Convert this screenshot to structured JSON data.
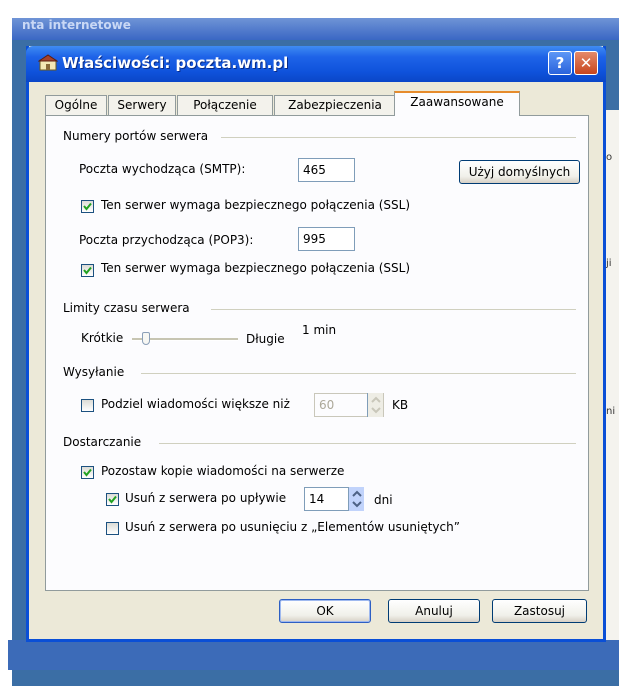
{
  "background": {
    "window_title_fragment": "nta internetowe",
    "right_fragments": [
      "o",
      "ji",
      "ni"
    ]
  },
  "dialog": {
    "title": "Właściwości: poczta.wm.pl",
    "help_glyph": "?",
    "close_glyph": "✕"
  },
  "tabs": [
    {
      "label": "Ogólne"
    },
    {
      "label": "Serwery"
    },
    {
      "label": "Połączenie"
    },
    {
      "label": "Zabezpieczenia"
    },
    {
      "label": "Zaawansowane"
    }
  ],
  "active_tab": "Zaawansowane",
  "ports": {
    "group_label": "Numery portów serwera",
    "smtp_label": "Poczta wychodząca (SMTP):",
    "smtp_value": "465",
    "default_button": "Użyj domyślnych",
    "ssl_smtp_label": "Ten serwer wymaga bezpiecznego połączenia (SSL)",
    "ssl_smtp_checked": true,
    "pop3_label": "Poczta przychodząca (POP3):",
    "pop3_value": "995",
    "ssl_pop3_label": "Ten serwer wymaga bezpiecznego połączenia (SSL)",
    "ssl_pop3_checked": true
  },
  "timeouts": {
    "group_label": "Limity czasu serwera",
    "short_label": "Krótkie",
    "long_label": "Długie",
    "value": "1 min",
    "slider_level": 0.1
  },
  "sending": {
    "group_label": "Wysyłanie",
    "split_label": "Podziel wiadomości większe niż",
    "split_checked": false,
    "split_value": "60",
    "unit": "KB"
  },
  "delivery": {
    "group_label": "Dostarczanie",
    "keep_copy_label": "Pozostaw kopie wiadomości na serwerze",
    "keep_copy_checked": true,
    "remove_after_label": "Usuń z serwera po upływie",
    "remove_after_checked": true,
    "remove_after_value": "14",
    "days_label": "dni",
    "remove_deleted_label": "Usuń z serwera po usunięciu z „Elementów usuniętych”",
    "remove_deleted_checked": false
  },
  "buttons": {
    "ok": "OK",
    "cancel": "Anuluj",
    "apply": "Zastosuj"
  }
}
